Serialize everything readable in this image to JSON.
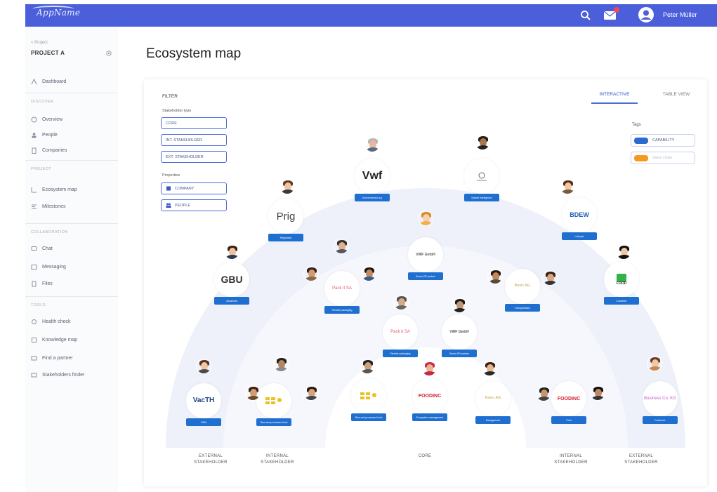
{
  "app": {
    "brand": "AppName",
    "user_name": "Peter Müller"
  },
  "colors": {
    "header": "#4a5fd9",
    "accent": "#1f6fd1",
    "outer_ring": "#eef0fa",
    "middle_ring": "#f6f7fc",
    "core": "#ffffff",
    "tag_capability": "#2a6bd1",
    "tag_second": "#f59a1e"
  },
  "sidebar": {
    "project_caption": "< Project",
    "project_name": "PROJECT A",
    "dashboard": "Dashboard",
    "section_discover": "DISCOVER",
    "overview": "Overview",
    "people": "People",
    "companies": "Companies",
    "section_project": "PROJECT",
    "ecosystem_map": "Ecosystem map",
    "milestones": "Milestones",
    "section_collaboration": "COLLABORATION",
    "chat": "Chat",
    "messaging": "Messaging",
    "files": "Files",
    "section_tools": "TOOLS",
    "health_check": "Health check",
    "knowledge_map": "Knowledge map",
    "find_partner": "Find a partner",
    "stakeholders_finder": "Stakeholders finder"
  },
  "page": {
    "title": "Ecosystem map"
  },
  "filter": {
    "title": "FILTER",
    "stakeholder_type": "Stakeholder type",
    "core": "CORE",
    "int_stakeholder": "INT. STAKEHOLDER",
    "ext_stakeholder": "EXT. STAKEHOLDER",
    "properties": "Properties",
    "company": "COMPANY",
    "people": "PEOPLE"
  },
  "tabs": {
    "interactive": "INTERACTIVE",
    "table_view": "TABLE VIEW"
  },
  "tags": {
    "title": "Tags",
    "capability": "CAPABILITY",
    "second": "Value chain"
  },
  "zones": {
    "ext_left": "EXTERNAL\nSTAKEHOLDER",
    "int_left": "INTERNAL\nSTAKEHOLDER",
    "core": "CORE",
    "int_right": "INTERNAL\nSTAKEHOLDER",
    "ext_right": "EXTERNAL\nSTAKEHOLDER"
  },
  "nodes": {
    "vwf": {
      "logo": "Vwf",
      "label": "Governmental org."
    },
    "market": {
      "logo": "",
      "label": "Market intelligence"
    },
    "prig": {
      "logo": "Prig",
      "label": "Regulation"
    },
    "bdew": {
      "logo": "BDEW",
      "label": "Lobbyist"
    },
    "gbu": {
      "logo": "GBU",
      "label": "Academia"
    },
    "food_right": {
      "logo": "FOOD",
      "label": "Customer"
    },
    "vwf_top": {
      "logo": "VWF GmbH",
      "label": "Sector ER partner"
    },
    "pack_mid": {
      "logo": "Pack it SA",
      "label": "Flexible packaging"
    },
    "basic_mid": {
      "logo": "Basic AG",
      "label": "Transportation"
    },
    "pack_core": {
      "logo": "Pack it SA",
      "label": "Flexible packaging"
    },
    "vwf_core": {
      "logo": "VWF GmbH",
      "label": "Sector ER partner"
    },
    "vacth": {
      "logo": "VacTH",
      "label": "OEM"
    },
    "raw_left": {
      "logo": "",
      "label": "Raw and processed food"
    },
    "raw_core": {
      "logo": "",
      "label": "Raw and processed food"
    },
    "foodinc_core": {
      "logo": "FOODINC",
      "label": "Ecosystem management"
    },
    "basic_core": {
      "logo": "Basic AG",
      "label": "Management"
    },
    "foodinc_right": {
      "logo": "FOODINC",
      "label": "Print"
    },
    "business_right": {
      "logo": "Business Co. KG",
      "label": "Customer"
    }
  }
}
